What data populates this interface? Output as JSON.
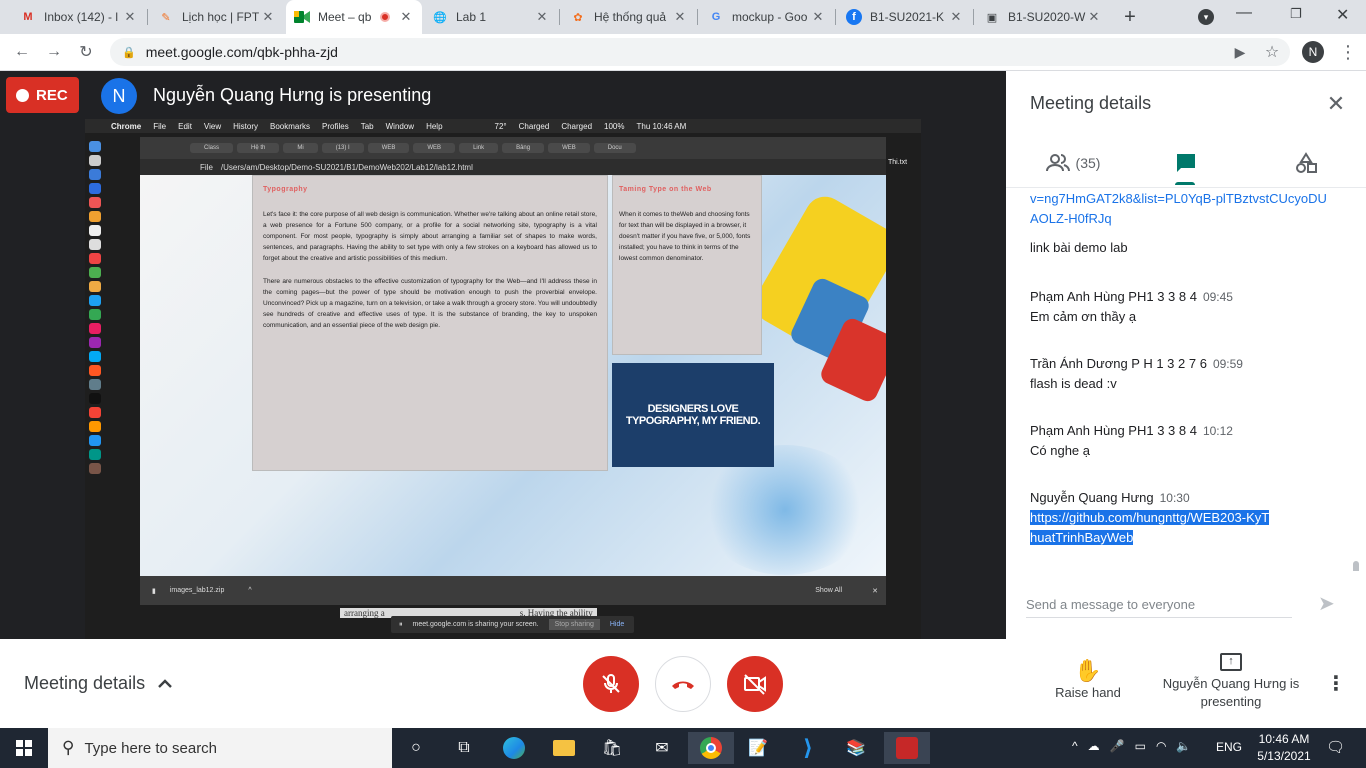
{
  "browser": {
    "tabs": [
      {
        "title": "Inbox (142) - l",
        "icon": "gmail-icon"
      },
      {
        "title": "Lịch học | FPT",
        "icon": "fpt-icon"
      },
      {
        "title": "Meet – qb",
        "icon": "meet-icon",
        "active": true
      },
      {
        "title": "Lab 1",
        "icon": "globe-icon"
      },
      {
        "title": "Hệ thống quả",
        "icon": "fpt-icon"
      },
      {
        "title": "mockup - Goo",
        "icon": "google-icon"
      },
      {
        "title": "B1-SU2021-K",
        "icon": "facebook-icon"
      },
      {
        "title": "B1-SU2020-W",
        "icon": "page-icon"
      }
    ],
    "url": "meet.google.com/qbk-phha-zjd",
    "profile_initial": "N"
  },
  "meet": {
    "rec_label": "REC",
    "presenter_initial": "N",
    "presenting_text": "Nguyễn Quang Hưng is presenting"
  },
  "shared_screen": {
    "mac_menu": [
      "Chrome",
      "File",
      "Edit",
      "View",
      "History",
      "Bookmarks",
      "Profiles",
      "Tab",
      "Window",
      "Help"
    ],
    "mac_status": [
      "72°",
      "Charged",
      "Charged",
      "100%",
      "Thu 10:46 AM"
    ],
    "inner_tabs": [
      "Class",
      "Hệ th",
      "Mi",
      "(13) I",
      "WEB",
      "WEB",
      "Link",
      "Bảng",
      "WEB",
      "Docu"
    ],
    "inner_url": "/Users/am/Desktop/Demo-SU2021/B1/DemoWeb202/Lab12/lab12.html",
    "inner_url_prefix": "File",
    "colA_title": "Typography",
    "colA_p1": "Let's face it: the core purpose of all web design is communication. Whether we're talking about an online retail store, a web presence for a Fortune 500 company, or a profile for a social networking site, typography is a vital component. For most people, typography is simply about arranging a familiar set of shapes to make words, sentences, and paragraphs. Having the ability to set type with only a few strokes on a keyboard has allowed us to forget about the creative and artistic possibilities of this medium.",
    "colA_p2": "There are numerous obstacles to the effective customization of typography for the Web—and I'll address these in the coming pages—but the power of type should be motivation enough to push the proverbial envelope. Unconvinced? Pick up a magazine, turn on a television, or take a walk through a grocery store. You will undoubtedly see hundreds of creative and effective uses of type. It is the substance of branding, the key to unspoken communication, and an essential piece of the web design pie.",
    "colB_title": "Taming Type on the Web",
    "colB_text": "When it comes to theWeb and choosing fonts for text than will be displayed in a browser, it doesn't matter if you have five, or 5,000, fonts installed; you have to think in terms of the lowest common denominator.",
    "designers_text": "DESIGNERS LOVE TYPOGRAPHY, MY FRIEND.",
    "download_file": "images_lab12.zip",
    "show_all": "Show All",
    "sharing_text": "meet.google.com is sharing your screen.",
    "stop_sharing": "Stop sharing",
    "hide": "Hide",
    "bg_text_left": "arranging a",
    "bg_text_right": "s. Having the ability",
    "right_file": "Thi.txt"
  },
  "panel": {
    "title": "Meeting details",
    "people_count": "(35)",
    "messages": [
      {
        "text_link": "v=ng7HmGAT2k8&list=PL0YqB-plTBztvstCUcyoDUAOLZ-H0fRJq"
      },
      {
        "text": "link bài demo lab"
      },
      {
        "author": "Phạm Anh Hùng PH1 3 3 8 4",
        "time": "09:45",
        "text": "Em cảm ơn thầy ạ"
      },
      {
        "author": "Trần Ánh Dương P H 1 3 2 7 6",
        "time": "09:59",
        "text": "flash is dead :v"
      },
      {
        "author": "Phạm Anh Hùng PH1 3 3 8 4",
        "time": "10:12",
        "text": "Có nghe ạ"
      },
      {
        "author": "Nguyễn Quang Hưng",
        "time": "10:30",
        "text_link": "https://github.com/hungnttg/WEB203-KyThuatTrinhBayWeb"
      }
    ],
    "input_placeholder": "Send a message to everyone"
  },
  "controls": {
    "meeting_details_label": "Meeting details",
    "raise_hand_label": "Raise hand",
    "presenting_label": "Nguyễn Quang Hưng is presenting",
    "mic_color": "#d93025",
    "cam_color": "#d93025",
    "hangup_color": "#d93025"
  },
  "taskbar": {
    "search_placeholder": "Type here to search",
    "lang": "ENG",
    "time": "10:46 AM",
    "date": "5/13/2021"
  }
}
